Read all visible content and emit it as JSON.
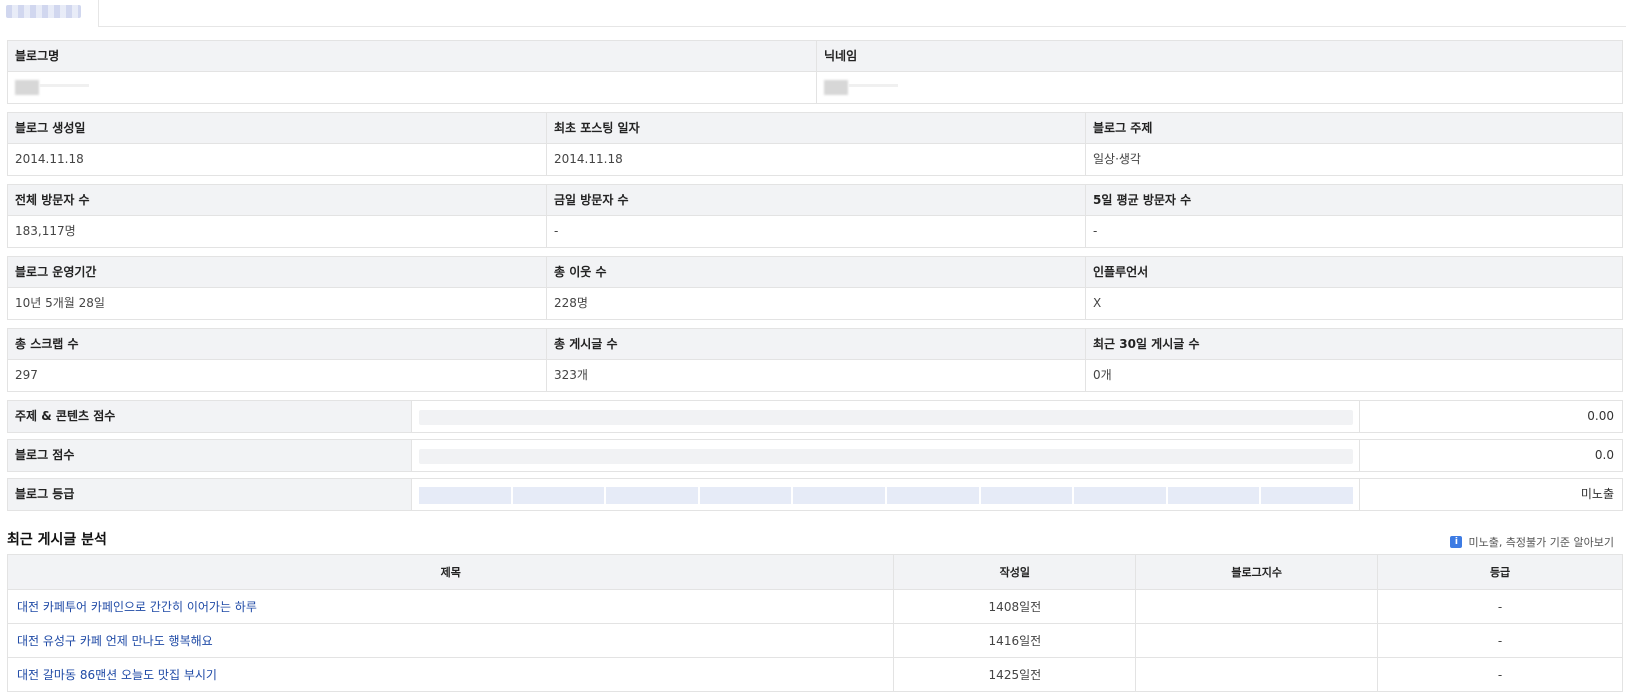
{
  "info_sections": [
    {
      "headers": [
        "블로그명",
        "닉네임"
      ],
      "values": [
        "",
        ""
      ]
    },
    {
      "headers": [
        "블로그 생성일",
        "최초 포스팅 일자",
        "블로그 주제"
      ],
      "values": [
        "2014.11.18",
        "2014.11.18",
        "일상·생각"
      ]
    },
    {
      "headers": [
        "전체 방문자 수",
        "금일 방문자 수",
        "5일 평균 방문자 수"
      ],
      "values": [
        "183,117명",
        "-",
        "-"
      ]
    },
    {
      "headers": [
        "블로그 운영기간",
        "총 이웃 수",
        "인플루언서"
      ],
      "values": [
        "10년 5개월 28일",
        "228명",
        "X"
      ]
    },
    {
      "headers": [
        "총 스크랩 수",
        "총 게시글 수",
        "최근 30일 게시글 수"
      ],
      "values": [
        "297",
        "323개",
        "0개"
      ]
    }
  ],
  "scores": [
    {
      "label": "주제 & 콘텐츠 점수",
      "value": "0.00",
      "level": 0
    },
    {
      "label": "블로그 점수",
      "value": "0.0",
      "level": 0
    },
    {
      "label": "블로그 등급",
      "value": "미노출",
      "segments_filled": 0,
      "segments_total": 10
    }
  ],
  "recent_posts": {
    "title": "최근 게시글 분석",
    "help_link": "미노출, 측정불가 기준 알아보기",
    "columns": [
      "제목",
      "작성일",
      "블로그지수",
      "등급"
    ],
    "rows": [
      {
        "title": "대전 카페투어 카페인으로 간간히 이어가는 하루",
        "date": "1408일전",
        "index": "",
        "grade": "-"
      },
      {
        "title": "대전 유성구 카페 언제 만나도 행복해요",
        "date": "1416일전",
        "index": "",
        "grade": "-"
      },
      {
        "title": "대전 갈마동 86맨션 오늘도 맛집 부시기",
        "date": "1425일전",
        "index": "",
        "grade": "-"
      }
    ]
  },
  "colors": {
    "header_bg": "#f2f3f5",
    "link": "#1f4aa6",
    "grade_segment": "#e6ebf7",
    "info_icon": "#3d7be3"
  }
}
